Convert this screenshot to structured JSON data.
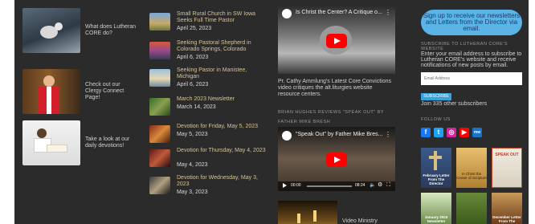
{
  "sidebar_links": [
    {
      "caption": "What does Lutheran CORE do?"
    },
    {
      "caption": "Check out our Clergy Connect Page!"
    },
    {
      "caption": "Take a look at our daily devotions!"
    }
  ],
  "posts": [
    {
      "title": "Small Rural Church in SW Iowa Seeks Full Time Pastor",
      "date": "April 25, 2023"
    },
    {
      "title": "Seeking Pastoral Shepherd in Colorado Springs, Colorado",
      "date": "April 6, 2023"
    },
    {
      "title": "Seeking Pastor in Manistee, Michigan",
      "date": "April 6, 2023"
    },
    {
      "title": "March 2023 Newsletter",
      "date": "March 14, 2023"
    },
    {
      "title": "Devotion for Friday, May 5, 2023",
      "date": "May 5, 2023"
    },
    {
      "title": "Devotion for Thursday, May 4, 2023",
      "date": "May 4, 2023"
    },
    {
      "title": "Devotion for Wednesday, May 3, 2023",
      "date": "May 3, 2023"
    }
  ],
  "videos": {
    "video1": {
      "title": "Is Christ the Center? A Critique o..."
    },
    "video1_caption": "Pr. Cathy Ammlung's Latest Core Convictions video critiques the alt.liturgies website resource centers.",
    "section_heading": "BRIAN HUGHES REVIEWS \"SPEAK OUT\" BY FATHER MIKE BRESH",
    "video2": {
      "title": "\"Speak Out\" by Father Mike Bres...",
      "time_current": "00:00",
      "time_total": "08:24"
    },
    "video_ministry_label": "Video Ministry"
  },
  "right": {
    "signup_label": "Sign up to receive our newsletters and Letters from the Director via email.",
    "subscribe_heading": "SUBSCRIBE TO LUTHERAN CORE'S WEBSITE",
    "subscribe_text": "Enter your email address to subscribe to Lutheran CORE's website and receive notifications of new posts by email.",
    "email_placeholder": "Email Address",
    "subscribe_button": "SUBSCRIBE",
    "subscribers_text": "Join 335 other subscribers",
    "follow_heading": "FOLLOW US",
    "social_icons": [
      "facebook-icon",
      "twitter-icon",
      "instagram-icon",
      "youtube-icon",
      "mewe-icon"
    ],
    "tiles": [
      {
        "label": "February Letter From The Director"
      },
      {
        "label": "In Christ the Center of Scripture"
      },
      {
        "label": "SPEAK OUT"
      },
      {
        "label": "January 2023 Newsletter"
      },
      {
        "label": ""
      },
      {
        "label": "December Letter From The Director"
      }
    ]
  },
  "colors": {
    "page_bg": "#2b2b2b",
    "accent_blue": "#5ab4e6",
    "post_title": "#d4c29b",
    "youtube_red": "#ff0000"
  }
}
